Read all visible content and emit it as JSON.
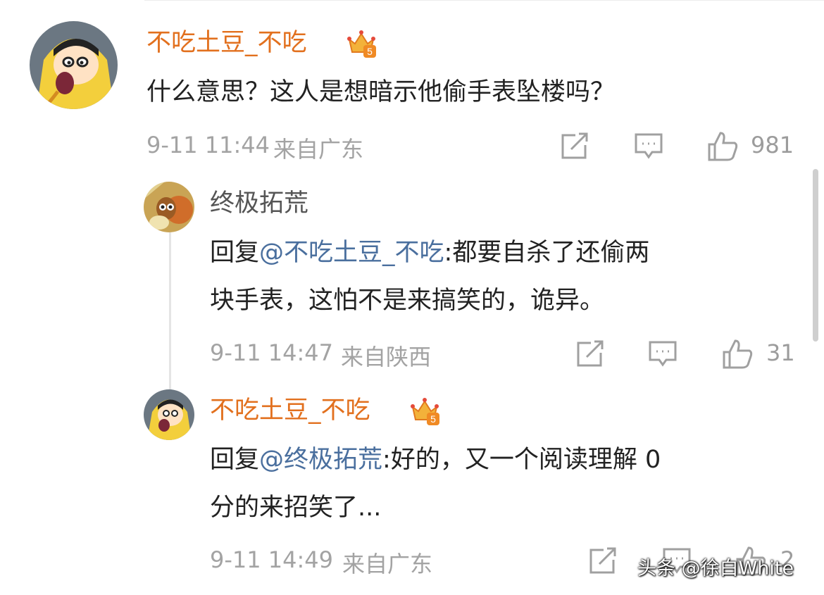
{
  "comment": {
    "author": "不吃土豆_不吃",
    "text": "什么意思？这人是想暗示他偷手表坠楼吗？",
    "time": "9-11 11:44",
    "location": "来自广东",
    "likes": "981",
    "badge_level": "5"
  },
  "replies": [
    {
      "author": "终极拓荒",
      "reply_prefix": "回复",
      "mention": "@不吃土豆_不吃",
      "line1_rest": ":都要自杀了还偷两",
      "line2": "块手表，这怕不是来搞笑的，诡异。",
      "time": "9-11 14:47",
      "location": "来自陕西",
      "likes": "31"
    },
    {
      "author": "不吃土豆_不吃",
      "reply_prefix": "回复",
      "mention": "@终极拓荒",
      "line1_rest": ":好的，又一个阅读理解 0",
      "line2": "分的来招笑了...",
      "time": "9-11 14:49",
      "location": "来自广东",
      "likes": "2",
      "badge_level": "5"
    }
  ],
  "watermark": "头条 @徐白White",
  "colors": {
    "author_name": "#e2701e",
    "mention": "#4a6f9e",
    "meta": "#a3a3a3"
  },
  "icons": [
    "share-icon",
    "comment-icon",
    "like-icon",
    "crown-badge-icon"
  ]
}
